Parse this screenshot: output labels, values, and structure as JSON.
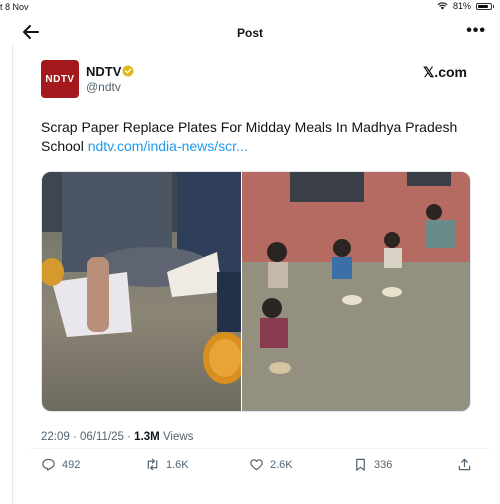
{
  "status_bar": {
    "time": "t 8 Nov",
    "battery": "81%",
    "battery_level": 0.81
  },
  "header": {
    "title": "Post"
  },
  "author": {
    "name": "NDTV",
    "handle": "@ndtv",
    "avatar_text": "NDTV",
    "avatar_color": "#a3191c"
  },
  "platform": {
    "logo": "𝕏.com"
  },
  "tweet": {
    "text": "Scrap Paper Replace Plates For Midday Meals In Madhya Pradesh School ",
    "link": "ndtv.com/india-news/scr..."
  },
  "meta": {
    "time": "22:09",
    "date": "06/11/25",
    "separator": " · ",
    "views_count": "1.3M",
    "views_label": " Views"
  },
  "actions": {
    "replies": "492",
    "reposts": "1.6K",
    "likes": "2.6K",
    "bookmarks": "336"
  },
  "colors": {
    "link": "#1d9bf0",
    "secondary_text": "#536471",
    "verified": "#e2b719"
  },
  "icons": [
    "back-arrow-icon",
    "more-icon",
    "verified-badge-icon",
    "reply-icon",
    "repost-icon",
    "like-icon",
    "bookmark-icon",
    "share-icon",
    "wifi-icon",
    "battery-icon"
  ]
}
